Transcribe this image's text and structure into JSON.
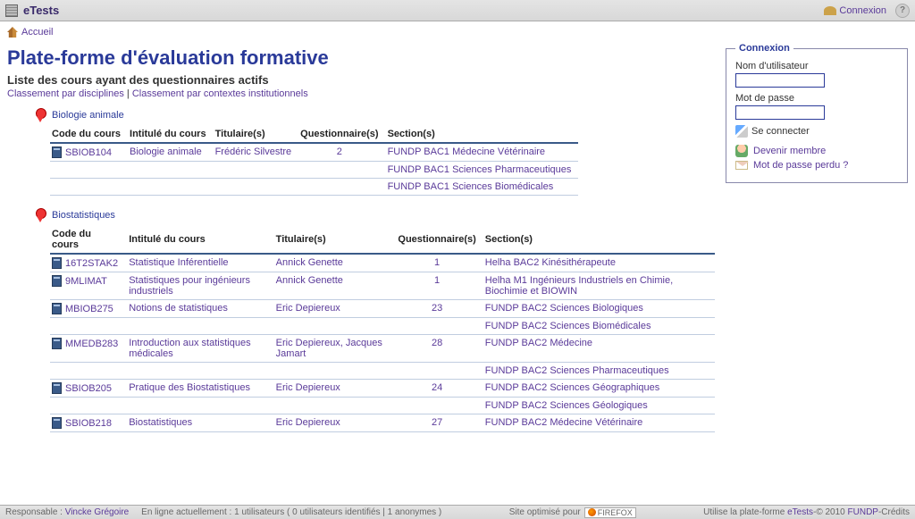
{
  "header": {
    "app_title": "eTests",
    "connexion": "Connexion"
  },
  "breadcrumb": {
    "home": "Accueil"
  },
  "page": {
    "title": "Plate-forme d'évaluation formative",
    "subtitle": "Liste des cours ayant des questionnaires actifs",
    "sort_discipline": "Classement par disciplines",
    "sort_context": "Classement par contextes institutionnels",
    "sep": " | "
  },
  "table_headers": {
    "code": "Code du cours",
    "intitule": "Intitulé du cours",
    "titulaire": "Titulaire(s)",
    "questionnaires": "Questionnaire(s)",
    "sections": "Section(s)"
  },
  "disciplines": [
    {
      "name": "Biologie animale",
      "courses": [
        {
          "code": "SBIOB104",
          "intitule": "Biologie animale",
          "titulaire": "Frédéric Silvestre",
          "questionnaires": "2",
          "sections": [
            "FUNDP BAC1 Médecine Vétérinaire",
            "FUNDP BAC1 Sciences Pharmaceutiques",
            "FUNDP BAC1 Sciences Biomédicales"
          ]
        }
      ]
    },
    {
      "name": "Biostatistiques",
      "courses": [
        {
          "code": "16T2STAK2",
          "intitule": "Statistique Inférentielle",
          "titulaire": "Annick Genette",
          "questionnaires": "1",
          "sections": [
            "Helha BAC2 Kinésithérapeute"
          ]
        },
        {
          "code": "9MLIMAT",
          "intitule": "Statistiques pour ingénieurs industriels",
          "titulaire": "Annick Genette",
          "questionnaires": "1",
          "sections": [
            "Helha M1 Ingénieurs Industriels en Chimie, Biochimie et BIOWIN"
          ]
        },
        {
          "code": "MBIOB275",
          "intitule": "Notions de statistiques",
          "titulaire": "Eric Depiereux",
          "questionnaires": "23",
          "sections": [
            "FUNDP BAC2 Sciences Biologiques",
            "FUNDP BAC2 Sciences Biomédicales"
          ]
        },
        {
          "code": "MMEDB283",
          "intitule": "Introduction aux statistiques médicales",
          "titulaire": "Eric Depiereux, Jacques Jamart",
          "questionnaires": "28",
          "sections": [
            "FUNDP BAC2 Médecine",
            "FUNDP BAC2 Sciences Pharmaceutiques"
          ]
        },
        {
          "code": "SBIOB205",
          "intitule": "Pratique des Biostatistiques",
          "titulaire": "Eric Depiereux",
          "questionnaires": "24",
          "sections": [
            "FUNDP BAC2 Sciences Géographiques",
            "FUNDP BAC2 Sciences Géologiques"
          ]
        },
        {
          "code": "SBIOB218",
          "intitule": "Biostatistiques",
          "titulaire": "Eric Depiereux",
          "questionnaires": "27",
          "sections": [
            "FUNDP BAC2 Médecine Vétérinaire"
          ]
        }
      ]
    }
  ],
  "login": {
    "legend": "Connexion",
    "username_label": "Nom d'utilisateur",
    "password_label": "Mot de passe",
    "submit": "Se connecter",
    "register": "Devenir membre",
    "forgot": "Mot de passe perdu ?"
  },
  "footer": {
    "responsible_label": "Responsable : ",
    "responsible_name": "Vincke Grégoire",
    "online": "En ligne actuellement : 1 utilisateurs ( 0 utilisateurs identifiés | 1 anonymes )",
    "optimized": "Site optimisé pour ",
    "firefox": "FIREFOX",
    "uses": "Utilise la plate-forme ",
    "etests": "eTests",
    "copyright": "-© 2010 ",
    "fundp": "FUNDP",
    "credits": "-Crédits"
  }
}
